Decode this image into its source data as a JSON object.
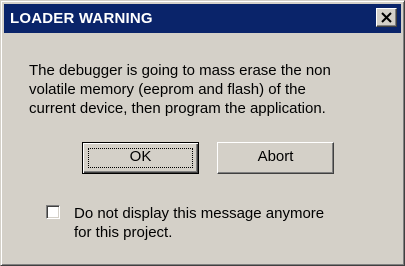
{
  "window": {
    "title": "LOADER WARNING",
    "close_icon": "close-icon"
  },
  "message": {
    "text": "The debugger is going to mass erase the non\nvolatile memory (eeprom and flash) of the\ncurrent device, then program the application."
  },
  "buttons": {
    "ok_label": "OK",
    "abort_label": "Abort",
    "default_button": "OK"
  },
  "option": {
    "checked": false,
    "label": "Do not display this message anymore\nfor this project."
  },
  "colors": {
    "titlebar": "#0a246a",
    "face": "#d4d0c8",
    "title_text": "#ffffff"
  }
}
